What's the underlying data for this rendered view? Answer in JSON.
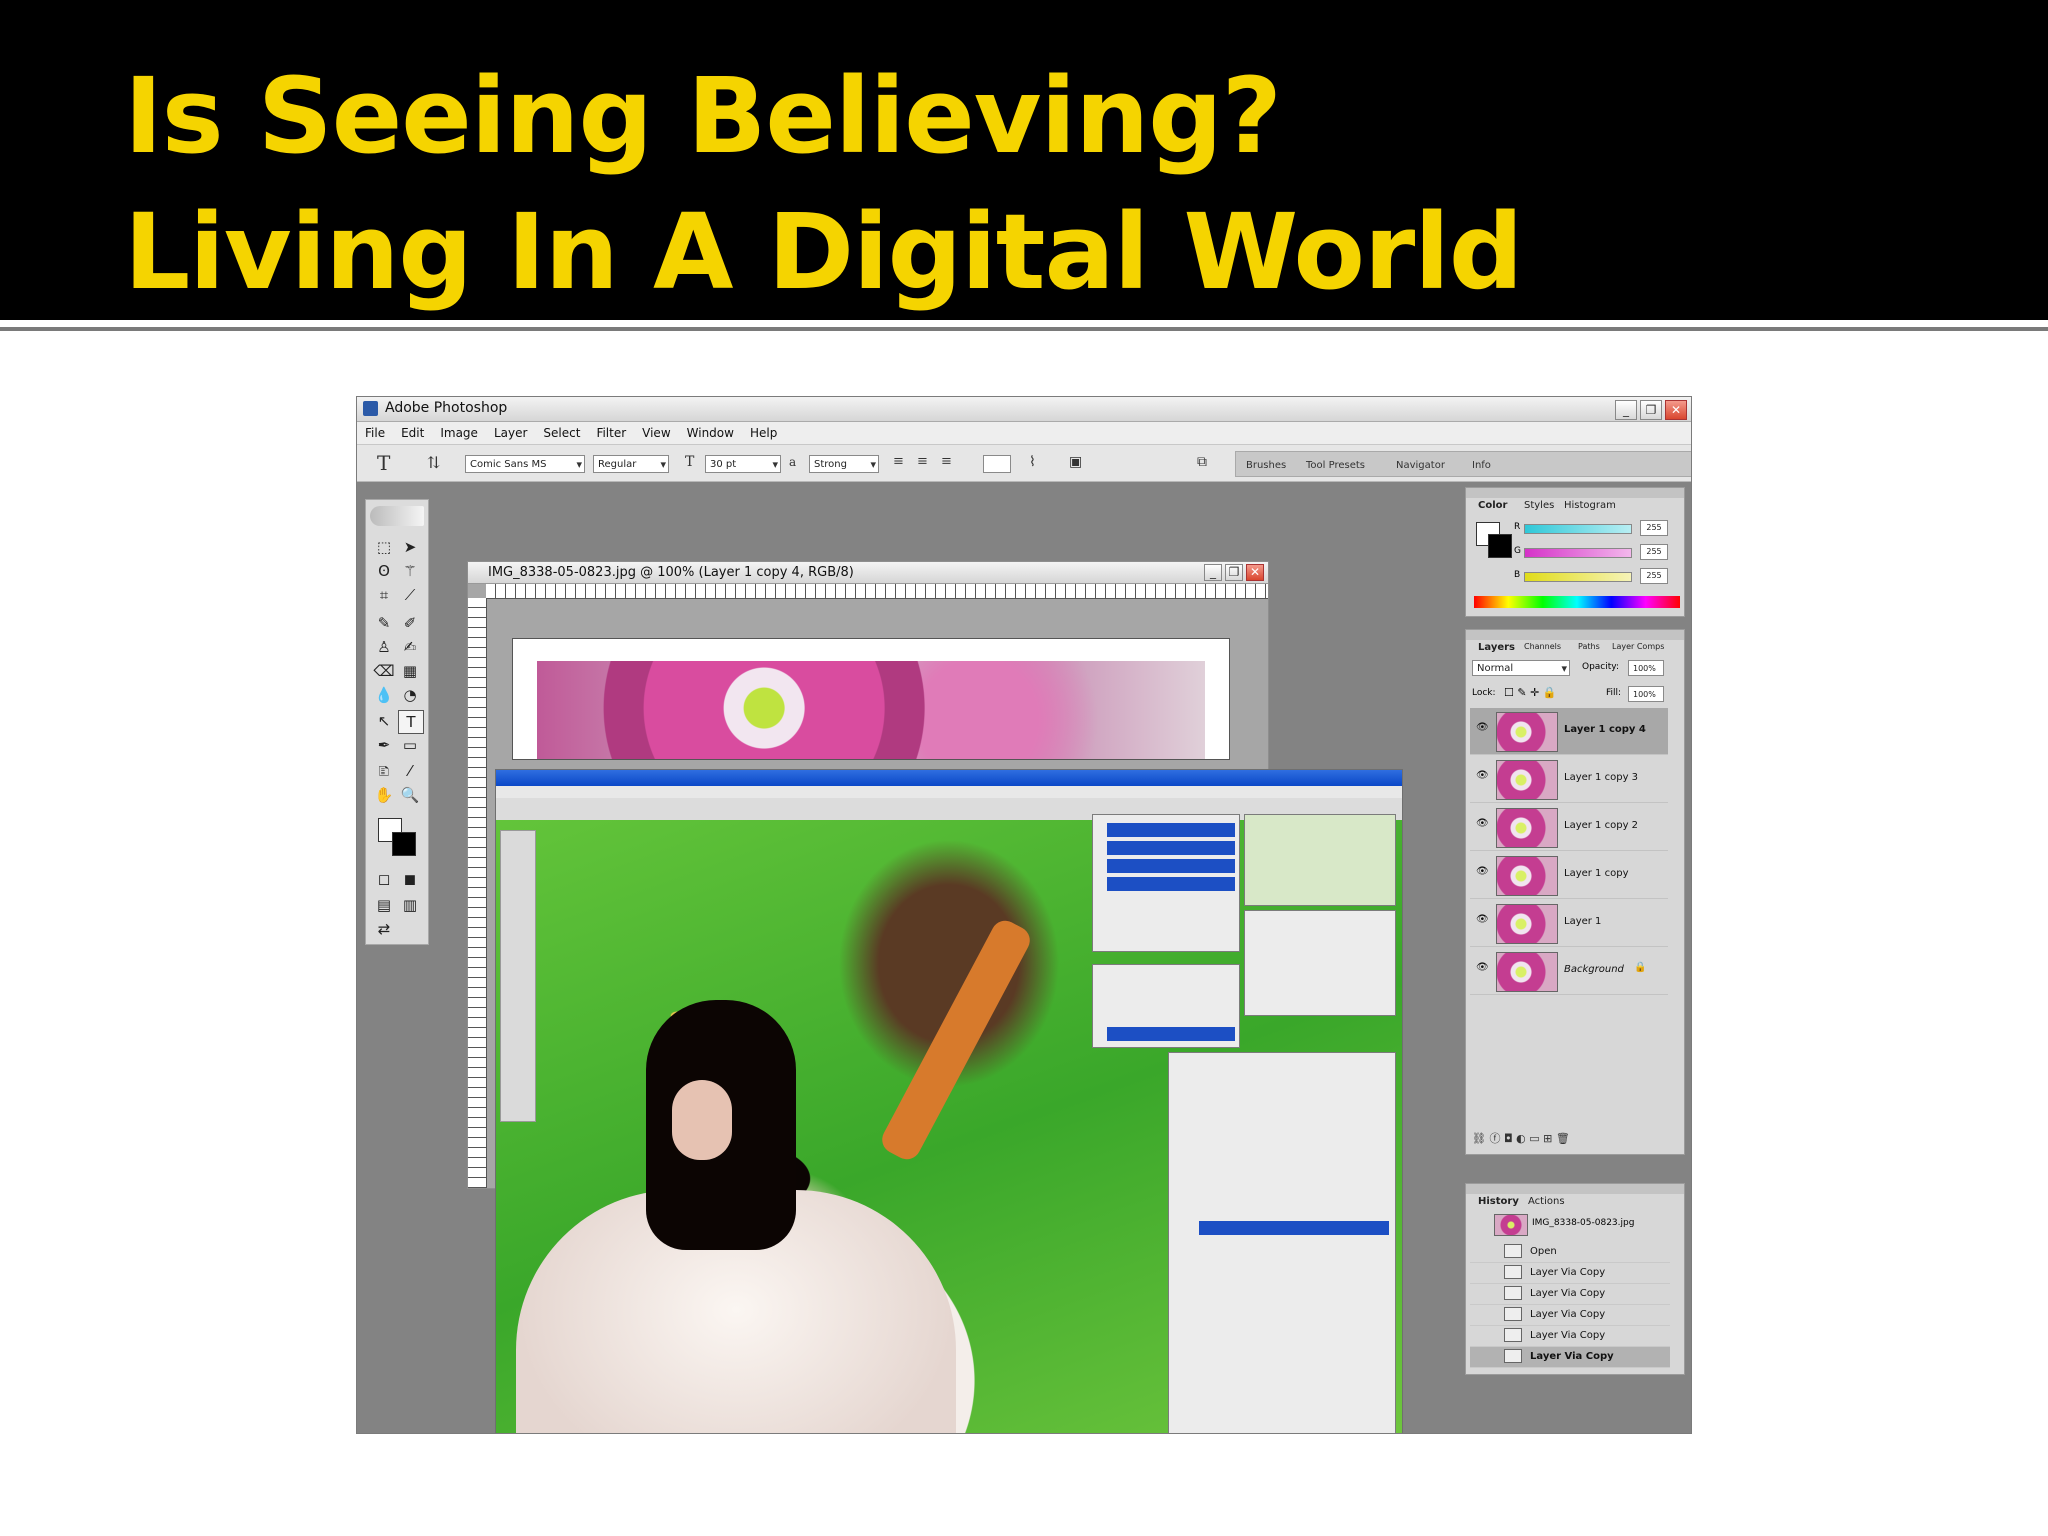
{
  "slide": {
    "title_line1": "Is Seeing Believing?",
    "title_line2": "Living In A Digital World"
  },
  "photoshop": {
    "window_title": "Adobe Photoshop",
    "menu": [
      "File",
      "Edit",
      "Image",
      "Layer",
      "Select",
      "Filter",
      "View",
      "Window",
      "Help"
    ],
    "options": {
      "tool_glyph": "T",
      "font_family": "Comic Sans MS",
      "font_style": "Regular",
      "font_size": "30 pt",
      "antialias_label": "a",
      "antialias": "Strong"
    },
    "palette_well_tabs": [
      "Brushes",
      "Tool Presets",
      "Navigator",
      "Info"
    ],
    "document": {
      "title": "IMG_8338-05-0823.jpg @ 100% (Layer 1 copy 4, RGB/8)"
    },
    "color_palette": {
      "tabs": [
        "Color",
        "Styles",
        "Histogram"
      ],
      "channels": [
        {
          "label": "R",
          "value": "255",
          "color": "#2fc8d8"
        },
        {
          "label": "G",
          "value": "255",
          "color": "#d532c8"
        },
        {
          "label": "B",
          "value": "255",
          "color": "#e0dc1a"
        }
      ]
    },
    "layers_palette": {
      "tabs": [
        "Layers",
        "Channels",
        "Paths",
        "Layer Comps"
      ],
      "blend_mode": "Normal",
      "opacity_label": "Opacity:",
      "opacity": "100%",
      "lock_label": "Lock:",
      "fill_label": "Fill:",
      "fill": "100%",
      "layers": [
        "Layer 1 copy 4",
        "Layer 1 copy 3",
        "Layer 1 copy 2",
        "Layer 1 copy",
        "Layer 1",
        "Background"
      ],
      "selected_index": 0
    },
    "history_palette": {
      "tabs": [
        "History",
        "Actions"
      ],
      "snapshot": "IMG_8338-05-0823.jpg",
      "steps": [
        "Open",
        "Layer Via Copy",
        "Layer Via Copy",
        "Layer Via Copy",
        "Layer Via Copy",
        "Layer Via Copy"
      ],
      "selected_index": 5
    }
  }
}
